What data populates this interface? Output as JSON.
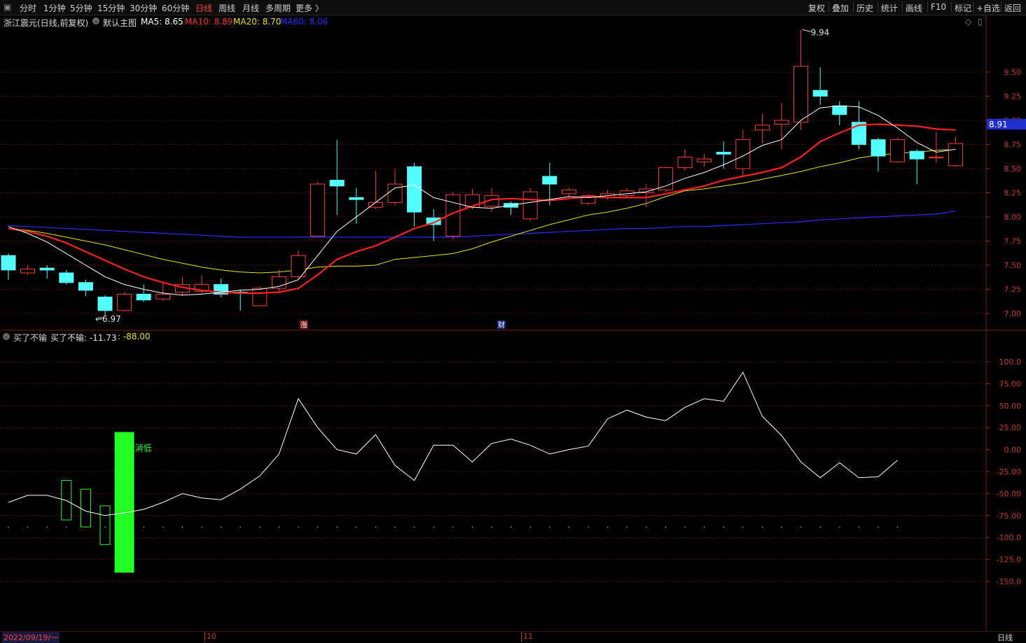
{
  "toolbar": {
    "timeframes": [
      {
        "label": "分时",
        "x": 28
      },
      {
        "label": "1分钟",
        "x": 62
      },
      {
        "label": "5分钟",
        "x": 100
      },
      {
        "label": "15分钟",
        "x": 139
      },
      {
        "label": "30分钟",
        "x": 185
      },
      {
        "label": "60分钟",
        "x": 231
      },
      {
        "label": "日线",
        "x": 279,
        "active": true
      },
      {
        "label": "周线",
        "x": 312
      },
      {
        "label": "月线",
        "x": 346
      },
      {
        "label": "多周期",
        "x": 379
      },
      {
        "label": "更多 〉",
        "x": 422
      }
    ],
    "buttons": [
      {
        "label": "复权",
        "x": 1154
      },
      {
        "label": "叠加",
        "x": 1188
      },
      {
        "label": "历史",
        "x": 1223
      },
      {
        "label": "统计",
        "x": 1258
      },
      {
        "label": "画线",
        "x": 1293
      },
      {
        "label": "F10",
        "x": 1329
      },
      {
        "label": "标记",
        "x": 1363
      },
      {
        "label": "+自选",
        "x": 1394
      },
      {
        "label": "返回",
        "x": 1434
      }
    ]
  },
  "info": {
    "stock": "浙江震元(日线,前复权)",
    "template": "默认主图",
    "ma5": "MA5: 8.65",
    "ma10": "MA10: 8.89",
    "ma20": "MA20: 8.70",
    "ma60": "MA60: 8.06"
  },
  "sub_info": {
    "name": "买了不输",
    "line1": "买了不输: -11.73",
    "line2": ": -88.00"
  },
  "markers": {
    "zhang": "涨",
    "cai": "财",
    "low_label": "6.97",
    "high_label": "9.94",
    "buy_label": "消低",
    "price_tag": "8.91"
  },
  "bottom": {
    "date": "2022/09/19/一",
    "m10": "10",
    "m11": "11",
    "period": "日线"
  },
  "colors": {
    "up": "#ff3b3b",
    "down": "#54ffff",
    "ma5": "#ffffff",
    "ma10": "#ff2020",
    "ma20": "#e6e600",
    "ma60": "#2a2aff",
    "buy_bar": "#22ff22"
  },
  "chart_data": [
    {
      "type": "candlestick",
      "title": "浙江震元(日线,前复权)",
      "y_ticks": [
        9.5,
        9.25,
        9.0,
        8.75,
        8.5,
        8.25,
        8.0,
        7.75,
        7.5,
        7.25,
        7.0
      ],
      "candles": [
        {
          "o": 7.6,
          "c": 7.45,
          "h": 7.62,
          "l": 7.35
        },
        {
          "o": 7.42,
          "c": 7.46,
          "h": 7.5,
          "l": 7.4
        },
        {
          "o": 7.47,
          "c": 7.45,
          "h": 7.5,
          "l": 7.36
        },
        {
          "o": 7.42,
          "c": 7.32,
          "h": 7.45,
          "l": 7.3
        },
        {
          "o": 7.32,
          "c": 7.24,
          "h": 7.35,
          "l": 7.18
        },
        {
          "o": 7.17,
          "c": 7.03,
          "h": 7.19,
          "l": 6.97
        },
        {
          "o": 7.03,
          "c": 7.2,
          "h": 7.22,
          "l": 7.02
        },
        {
          "o": 7.2,
          "c": 7.14,
          "h": 7.3,
          "l": 7.12
        },
        {
          "o": 7.15,
          "c": 7.2,
          "h": 7.32,
          "l": 7.13
        },
        {
          "o": 7.22,
          "c": 7.3,
          "h": 7.38,
          "l": 7.18
        },
        {
          "o": 7.23,
          "c": 7.3,
          "h": 7.4,
          "l": 7.2
        },
        {
          "o": 7.3,
          "c": 7.2,
          "h": 7.36,
          "l": 7.17
        },
        {
          "o": 7.22,
          "c": 7.21,
          "h": 7.25,
          "l": 7.03
        },
        {
          "o": 7.08,
          "c": 7.26,
          "h": 7.28,
          "l": 7.07
        },
        {
          "o": 7.26,
          "c": 7.38,
          "h": 7.45,
          "l": 7.22
        },
        {
          "o": 7.38,
          "c": 7.6,
          "h": 7.65,
          "l": 7.36
        },
        {
          "o": 7.8,
          "c": 8.34,
          "h": 8.36,
          "l": 7.8
        },
        {
          "o": 8.38,
          "c": 8.32,
          "h": 8.8,
          "l": 8.02
        },
        {
          "o": 8.2,
          "c": 8.18,
          "h": 8.3,
          "l": 7.93
        },
        {
          "o": 8.1,
          "c": 8.15,
          "h": 8.48,
          "l": 8.08
        },
        {
          "o": 8.15,
          "c": 8.34,
          "h": 8.5,
          "l": 8.12
        },
        {
          "o": 8.52,
          "c": 8.05,
          "h": 8.56,
          "l": 7.9
        },
        {
          "o": 7.99,
          "c": 7.92,
          "h": 8.08,
          "l": 7.75
        },
        {
          "o": 7.8,
          "c": 8.23,
          "h": 8.26,
          "l": 7.77
        },
        {
          "o": 8.1,
          "c": 8.23,
          "h": 8.29,
          "l": 8.08
        },
        {
          "o": 8.11,
          "c": 8.22,
          "h": 8.3,
          "l": 8.05
        },
        {
          "o": 8.14,
          "c": 8.1,
          "h": 8.16,
          "l": 8.02
        },
        {
          "o": 7.98,
          "c": 8.26,
          "h": 8.3,
          "l": 7.96
        },
        {
          "o": 8.42,
          "c": 8.34,
          "h": 8.56,
          "l": 8.12
        },
        {
          "o": 8.24,
          "c": 8.28,
          "h": 8.3,
          "l": 8.2
        },
        {
          "o": 8.14,
          "c": 8.22,
          "h": 8.24,
          "l": 8.12
        },
        {
          "o": 8.2,
          "c": 8.24,
          "h": 8.28,
          "l": 8.18
        },
        {
          "o": 8.22,
          "c": 8.27,
          "h": 8.3,
          "l": 8.2
        },
        {
          "o": 8.25,
          "c": 8.29,
          "h": 8.34,
          "l": 8.1
        },
        {
          "o": 8.28,
          "c": 8.51,
          "h": 8.52,
          "l": 8.26
        },
        {
          "o": 8.51,
          "c": 8.62,
          "h": 8.7,
          "l": 8.48
        },
        {
          "o": 8.57,
          "c": 8.6,
          "h": 8.65,
          "l": 8.52
        },
        {
          "o": 8.67,
          "c": 8.65,
          "h": 8.78,
          "l": 8.5
        },
        {
          "o": 8.5,
          "c": 8.8,
          "h": 8.9,
          "l": 8.42
        },
        {
          "o": 8.9,
          "c": 8.95,
          "h": 9.07,
          "l": 8.76
        },
        {
          "o": 8.96,
          "c": 9.0,
          "h": 9.18,
          "l": 8.7
        },
        {
          "o": 8.98,
          "c": 9.56,
          "h": 9.94,
          "l": 8.9
        },
        {
          "o": 9.31,
          "c": 9.25,
          "h": 9.55,
          "l": 9.16
        },
        {
          "o": 9.15,
          "c": 9.06,
          "h": 9.2,
          "l": 8.95
        },
        {
          "o": 8.98,
          "c": 8.75,
          "h": 9.2,
          "l": 8.7
        },
        {
          "o": 8.8,
          "c": 8.63,
          "h": 8.82,
          "l": 8.47
        },
        {
          "o": 8.57,
          "c": 8.8,
          "h": 8.82,
          "l": 8.56
        },
        {
          "o": 8.68,
          "c": 8.6,
          "h": 8.7,
          "l": 8.34
        },
        {
          "o": 8.61,
          "c": 8.62,
          "h": 8.88,
          "l": 8.56
        },
        {
          "o": 8.53,
          "c": 8.76,
          "h": 8.83,
          "l": 8.52
        }
      ],
      "ma": {
        "MA5": [
          7.9,
          7.83,
          7.74,
          7.62,
          7.5,
          7.38,
          7.3,
          7.25,
          7.21,
          7.19,
          7.2,
          7.22,
          7.24,
          7.25,
          7.28,
          7.35,
          7.6,
          7.85,
          8.0,
          8.15,
          8.3,
          8.33,
          8.2,
          8.15,
          8.1,
          8.09,
          8.12,
          8.15,
          8.18,
          8.21,
          8.2,
          8.22,
          8.24,
          8.26,
          8.32,
          8.4,
          8.46,
          8.54,
          8.63,
          8.74,
          8.8,
          9.0,
          9.13,
          9.15,
          9.14,
          9.05,
          8.92,
          8.77,
          8.67,
          8.7
        ],
        "MA10": [
          7.88,
          7.85,
          7.8,
          7.73,
          7.64,
          7.55,
          7.46,
          7.38,
          7.32,
          7.27,
          7.24,
          7.22,
          7.21,
          7.21,
          7.22,
          7.26,
          7.4,
          7.56,
          7.64,
          7.7,
          7.79,
          7.88,
          7.94,
          8.04,
          8.11,
          8.18,
          8.19,
          8.18,
          8.17,
          8.19,
          8.21,
          8.2,
          8.2,
          8.2,
          8.24,
          8.28,
          8.32,
          8.38,
          8.42,
          8.46,
          8.51,
          8.62,
          8.78,
          8.87,
          8.95,
          8.96,
          8.95,
          8.94,
          8.91,
          8.9
        ],
        "MA20": [
          7.88,
          7.86,
          7.83,
          7.79,
          7.75,
          7.71,
          7.66,
          7.61,
          7.56,
          7.52,
          7.48,
          7.45,
          7.43,
          7.42,
          7.43,
          7.45,
          7.48,
          7.49,
          7.49,
          7.5,
          7.56,
          7.58,
          7.6,
          7.62,
          7.67,
          7.74,
          7.8,
          7.86,
          7.92,
          7.97,
          8.02,
          8.05,
          8.09,
          8.14,
          8.21,
          8.27,
          8.29,
          8.32,
          8.35,
          8.39,
          8.43,
          8.47,
          8.52,
          8.56,
          8.61,
          8.64,
          8.66,
          8.67,
          8.69,
          8.7
        ],
        "MA60": [
          7.91,
          7.9,
          7.89,
          7.88,
          7.87,
          7.86,
          7.85,
          7.84,
          7.83,
          7.82,
          7.81,
          7.8,
          7.79,
          7.79,
          7.79,
          7.79,
          7.79,
          7.79,
          7.79,
          7.79,
          7.79,
          7.79,
          7.79,
          7.79,
          7.8,
          7.81,
          7.82,
          7.83,
          7.84,
          7.85,
          7.86,
          7.87,
          7.88,
          7.88,
          7.89,
          7.9,
          7.9,
          7.91,
          7.92,
          7.93,
          7.94,
          7.95,
          7.97,
          7.98,
          7.99,
          8.0,
          8.01,
          8.02,
          8.03,
          8.06
        ]
      }
    },
    {
      "type": "line",
      "title": "买了不输",
      "y_ticks": [
        100.0,
        75.0,
        50.0,
        25.0,
        0.0,
        -25.0,
        -50.0,
        -75.0,
        -100.0,
        -125.0,
        -150.0
      ],
      "line": [
        -60,
        -52,
        -52,
        -58,
        -70,
        -75,
        -72,
        -68,
        -60,
        -50,
        -55,
        -57,
        -45,
        -30,
        -5,
        58,
        25,
        0,
        -5,
        17,
        -18,
        -35,
        5,
        5,
        -14,
        7,
        12,
        5,
        -5,
        0,
        4,
        35,
        45,
        37,
        33,
        48,
        58,
        55,
        88,
        38,
        16,
        -14,
        -32,
        -15,
        -32,
        -31,
        -12
      ],
      "dotted_level": -88,
      "open_bars": [
        {
          "index": 3,
          "top": -35,
          "bottom": -80
        },
        {
          "index": 4,
          "top": -45,
          "bottom": -88
        },
        {
          "index": 5,
          "top": -64,
          "bottom": -108
        }
      ],
      "buy_bar": {
        "index": 6,
        "top": 20,
        "bottom": -140
      }
    }
  ]
}
